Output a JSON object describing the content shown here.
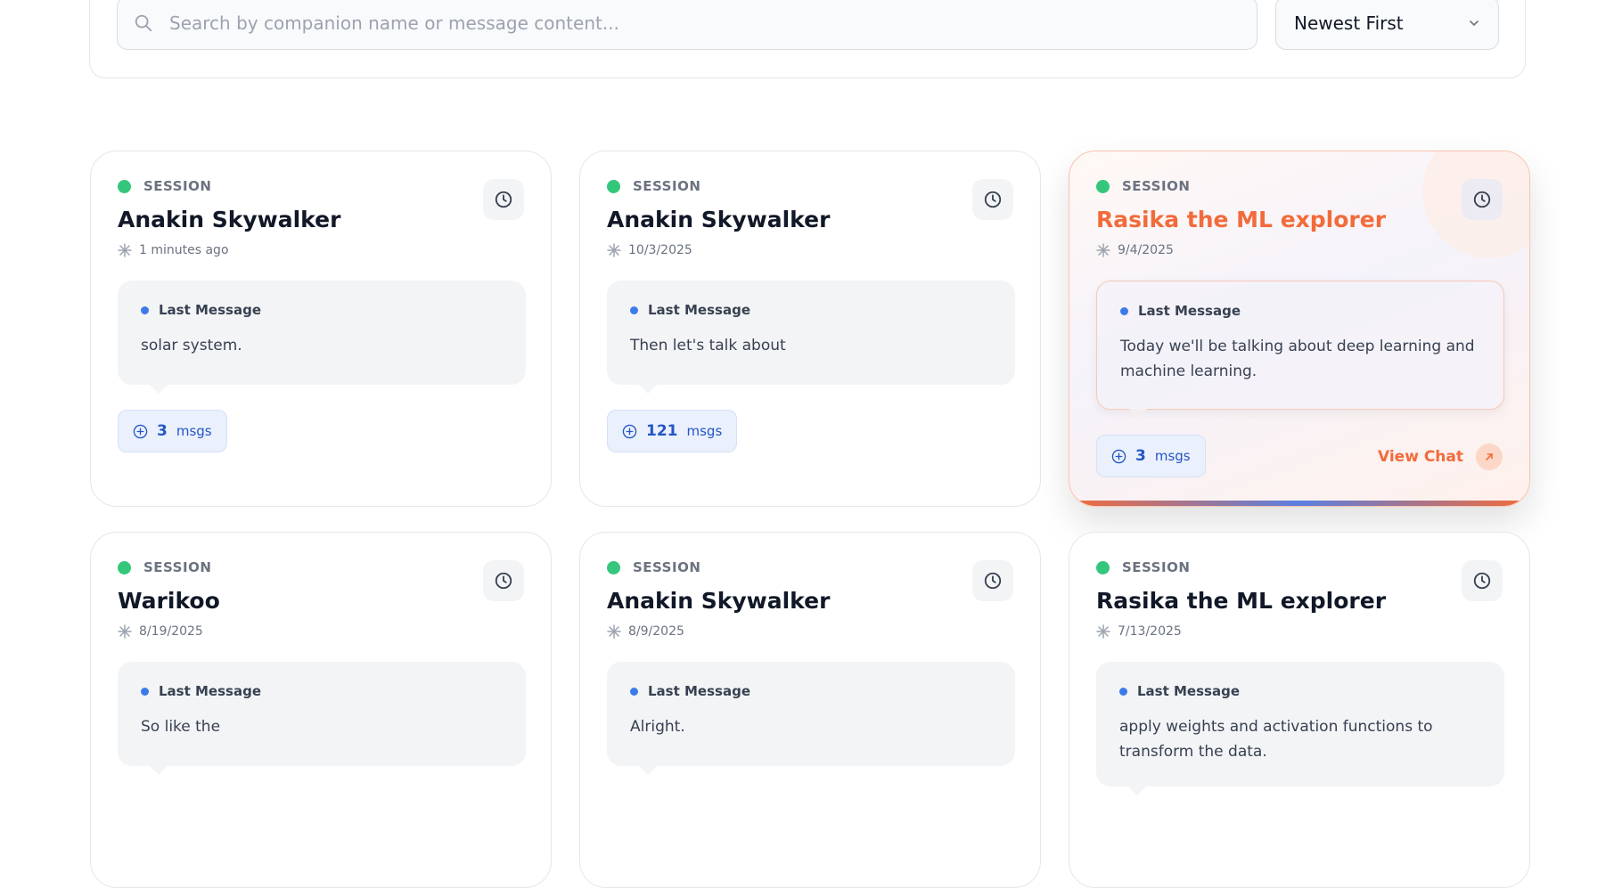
{
  "search": {
    "placeholder": "Search by companion name or message content..."
  },
  "sort": {
    "selected": "Newest First"
  },
  "cards": [
    {
      "session_label": "SESSION",
      "name": "Anakin Skywalker",
      "date": "1 minutes ago",
      "msg_label": "Last Message",
      "msg": "solar system.",
      "count": "3",
      "unit": "msgs"
    },
    {
      "session_label": "SESSION",
      "name": "Anakin Skywalker",
      "date": "10/3/2025",
      "msg_label": "Last Message",
      "msg": "Then let's talk about",
      "count": "121",
      "unit": "msgs"
    },
    {
      "session_label": "SESSION",
      "name": "Rasika the ML explorer",
      "date": "9/4/2025",
      "msg_label": "Last Message",
      "msg": "Today we'll be talking about deep learning and machine learning.",
      "count": "3",
      "unit": "msgs",
      "action": "View Chat"
    },
    {
      "session_label": "SESSION",
      "name": "Warikoo",
      "date": "8/19/2025",
      "msg_label": "Last Message",
      "msg": "So like the"
    },
    {
      "session_label": "SESSION",
      "name": "Anakin Skywalker",
      "date": "8/9/2025",
      "msg_label": "Last Message",
      "msg": "Alright."
    },
    {
      "session_label": "SESSION",
      "name": "Rasika the ML explorer",
      "date": "7/13/2025",
      "msg_label": "Last Message",
      "msg": "apply weights and activation functions to transform the data."
    }
  ],
  "colors": {
    "accent": "#f26b3a",
    "status": "#34c77b",
    "link_blue": "#2456c4"
  }
}
